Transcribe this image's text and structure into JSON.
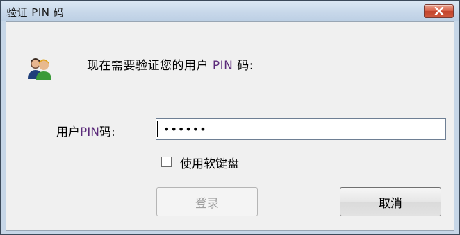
{
  "window": {
    "title": "验证 PIN 码"
  },
  "prompt": {
    "before": "现在需要验证您的用户 ",
    "pin": "PIN",
    "after": " 码:"
  },
  "pin_field": {
    "label_before": "用户",
    "label_pin": "PIN",
    "label_after": "码:",
    "value": "••••••"
  },
  "checkbox": {
    "label": "使用软键盘",
    "checked": false
  },
  "buttons": {
    "login_label": "登录",
    "login_enabled": false,
    "cancel_label": "取消"
  },
  "icons": {
    "users": "users-icon",
    "close": "close-icon",
    "close_color": "#d8624a"
  }
}
